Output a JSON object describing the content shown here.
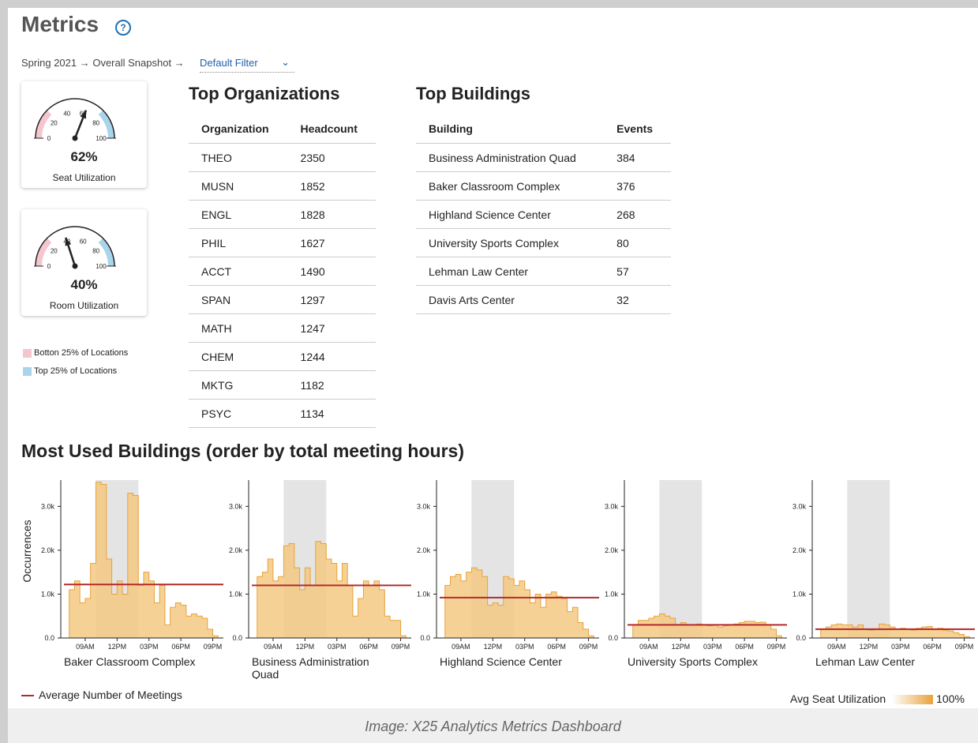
{
  "header": {
    "title": "Metrics",
    "help_icon": "question-circle-icon"
  },
  "breadcrumb": {
    "path": "Spring 2021 → Overall Snapshot →",
    "filter_value": "Default Filter"
  },
  "gauges": [
    {
      "value": "62%",
      "label": "Seat Utilization",
      "needle": 62
    },
    {
      "value": "40%",
      "label": "Room Utilization",
      "needle": 40
    }
  ],
  "gauge_ticks": [
    "0",
    "20",
    "40",
    "60",
    "80",
    "100"
  ],
  "legend": {
    "bottom": "Botton 25% of Locations",
    "top": "Top 25% of Locations",
    "bottom_color": "#f6c6cf",
    "top_color": "#a8d4ec"
  },
  "top_orgs": {
    "title": "Top Organizations",
    "columns": [
      "Organization",
      "Headcount"
    ],
    "rows": [
      [
        "THEO",
        "2350"
      ],
      [
        "MUSN",
        "1852"
      ],
      [
        "ENGL",
        "1828"
      ],
      [
        "PHIL",
        "1627"
      ],
      [
        "ACCT",
        "1490"
      ],
      [
        "SPAN",
        "1297"
      ],
      [
        "MATH",
        "1247"
      ],
      [
        "CHEM",
        "1244"
      ],
      [
        "MKTG",
        "1182"
      ],
      [
        "PSYC",
        "1134"
      ]
    ]
  },
  "top_buildings": {
    "title": "Top Buildings",
    "columns": [
      "Building",
      "Events"
    ],
    "rows": [
      [
        "Business Administration Quad",
        "384"
      ],
      [
        "Baker Classroom Complex",
        "376"
      ],
      [
        "Highland Science Center",
        "268"
      ],
      [
        "University Sports Complex",
        "80"
      ],
      [
        "Lehman Law Center",
        "57"
      ],
      [
        "Davis Arts Center",
        "32"
      ]
    ]
  },
  "most_used": {
    "title": "Most Used Buildings (order by total meeting hours)",
    "avg_legend": "Average Number of Meetings",
    "util_legend": "Avg Seat Utilization",
    "util_max": "100%"
  },
  "footer": {
    "caption": "Image: X25 Analytics Metrics Dashboard"
  },
  "chart_data": {
    "type": "area",
    "ylabel": "Occurrences",
    "y_ticks": [
      "0.0",
      "1.0k",
      "2.0k",
      "3.0k"
    ],
    "x_ticks": [
      "09AM",
      "12PM",
      "03PM",
      "06PM",
      "09PM"
    ],
    "ylim": [
      0,
      3600
    ],
    "xlim": [
      7,
      22
    ],
    "shaded_hours": [
      10,
      14
    ],
    "colors": {
      "area": "#f4c983",
      "stroke": "#e8a23c",
      "avg": "#b32a2a",
      "shade": "#d8d8d8"
    },
    "series": [
      {
        "name": "Baker Classroom Complex",
        "x": [
          7,
          7.5,
          8,
          8.5,
          9,
          9.5,
          10,
          10.5,
          11,
          11.5,
          12,
          12.5,
          13,
          13.5,
          14,
          14.5,
          15,
          15.5,
          16,
          16.5,
          17,
          17.5,
          18,
          18.5,
          19,
          19.5,
          20,
          20.5,
          21,
          21.5
        ],
        "y": [
          0,
          1100,
          1300,
          800,
          900,
          1700,
          3550,
          3500,
          1800,
          1000,
          1300,
          1000,
          3300,
          3250,
          1200,
          1500,
          1300,
          800,
          1200,
          300,
          700,
          800,
          750,
          500,
          550,
          500,
          450,
          200,
          50,
          0
        ],
        "avg": 1220
      },
      {
        "name": "Business Administration Quad",
        "x": [
          7,
          7.5,
          8,
          8.5,
          9,
          9.5,
          10,
          10.5,
          11,
          11.5,
          12,
          12.5,
          13,
          13.5,
          14,
          14.5,
          15,
          15.5,
          16,
          16.5,
          17,
          17.5,
          18,
          18.5,
          19,
          19.5,
          20,
          20.5,
          21,
          21.5
        ],
        "y": [
          0,
          1400,
          1500,
          1800,
          1300,
          1400,
          2100,
          2150,
          1600,
          1100,
          1600,
          1200,
          2200,
          2150,
          1800,
          1700,
          1300,
          1700,
          1200,
          500,
          900,
          1300,
          1200,
          1300,
          1100,
          500,
          400,
          400,
          50,
          0
        ],
        "avg": 1200
      },
      {
        "name": "Business Administration Quad",
        "x": [
          7,
          7.5,
          8,
          8.5,
          9,
          9.5,
          10,
          10.5,
          11,
          11.5,
          12,
          12.5,
          13,
          13.5,
          14,
          14.5,
          15,
          15.5,
          16,
          16.5,
          17,
          17.5,
          18,
          18.5,
          19,
          19.5,
          20,
          20.5,
          21,
          21.5
        ],
        "y": [
          0,
          1200,
          1400,
          1450,
          1300,
          1500,
          1600,
          1550,
          1400,
          750,
          800,
          750,
          1400,
          1350,
          1200,
          1300,
          1100,
          800,
          1000,
          700,
          1000,
          1050,
          950,
          900,
          600,
          700,
          350,
          200,
          50,
          0
        ],
        "avg": 920
      },
      {
        "name": "University Sports Complex",
        "x": [
          7,
          7.5,
          8,
          8.5,
          9,
          9.5,
          10,
          10.5,
          11,
          11.5,
          12,
          12.5,
          13,
          13.5,
          14,
          14.5,
          15,
          15.5,
          16,
          16.5,
          17,
          17.5,
          18,
          18.5,
          19,
          19.5,
          20,
          20.5,
          21,
          21.5
        ],
        "y": [
          0,
          300,
          400,
          400,
          450,
          500,
          550,
          500,
          450,
          300,
          350,
          300,
          300,
          320,
          300,
          280,
          300,
          250,
          280,
          300,
          320,
          350,
          380,
          380,
          350,
          360,
          300,
          200,
          50,
          0
        ],
        "avg": 300
      },
      {
        "name": "Lehman Law Center",
        "x": [
          7,
          7.5,
          8,
          8.5,
          9,
          9.5,
          10,
          10.5,
          11,
          11.5,
          12,
          12.5,
          13,
          13.5,
          14,
          14.5,
          15,
          15.5,
          16,
          16.5,
          17,
          17.5,
          18,
          18.5,
          19,
          19.5,
          20,
          20.5,
          21,
          21.5
        ],
        "y": [
          0,
          200,
          250,
          300,
          320,
          300,
          300,
          250,
          300,
          200,
          180,
          200,
          320,
          300,
          250,
          200,
          220,
          200,
          180,
          220,
          250,
          260,
          200,
          220,
          180,
          160,
          120,
          80,
          30,
          0
        ],
        "avg": 200
      }
    ],
    "panel_titles": [
      [
        "Baker Classroom Complex"
      ],
      [
        "Business Administration",
        "Quad"
      ],
      [
        "Highland Science Center"
      ],
      [
        "University Sports Complex"
      ],
      [
        "Lehman Law Center"
      ]
    ]
  }
}
